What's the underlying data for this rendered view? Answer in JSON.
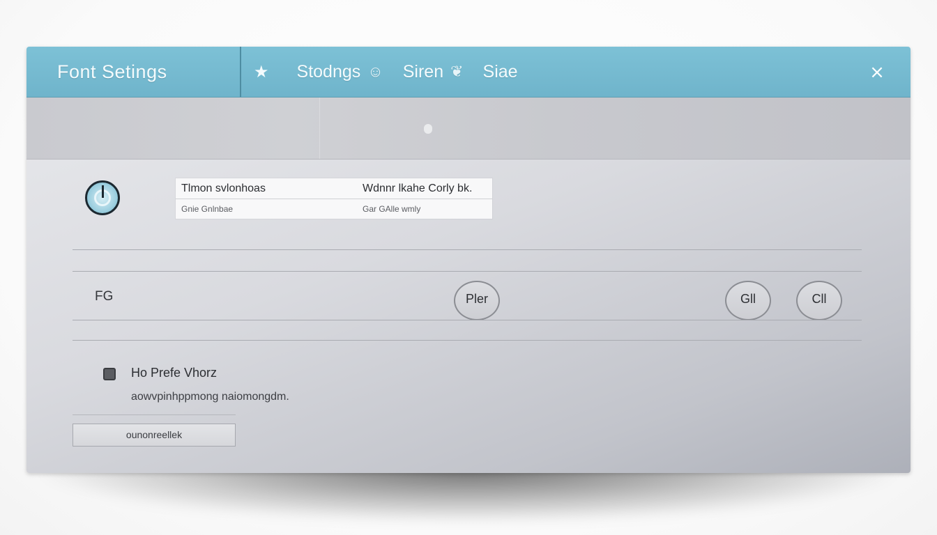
{
  "window": {
    "title": "Font Setings",
    "close_glyph": "⨯"
  },
  "tabs": [
    {
      "glyph": "★",
      "icon": "star-icon"
    },
    {
      "label": "Stodngs",
      "glyph": "☺",
      "icon": "face-icon"
    },
    {
      "label": "Siren",
      "glyph": "❦",
      "icon": "heart-flourish-icon"
    },
    {
      "label": "Siae"
    }
  ],
  "font_table": {
    "headers": [
      "Tlmon svlonhoas",
      "Wdnnr lkahe Corly bk."
    ],
    "sub": [
      "Gnie  Gnlnbae",
      "Gar  GAlle wmly"
    ]
  },
  "font_row": {
    "label": "FG",
    "buttons": [
      "Pler",
      "Gll",
      "Cll"
    ]
  },
  "option": {
    "label": "Ho   Prefe Vhorz",
    "description": "aowvpinhppmong naiomongdm.",
    "checked": true
  },
  "action": {
    "label": "ounonreellek"
  },
  "colors": {
    "header": "#7dc1d6",
    "header_divider": "#4e8da2",
    "panel": "#d9dadf",
    "text_dark": "#2b2d31"
  }
}
